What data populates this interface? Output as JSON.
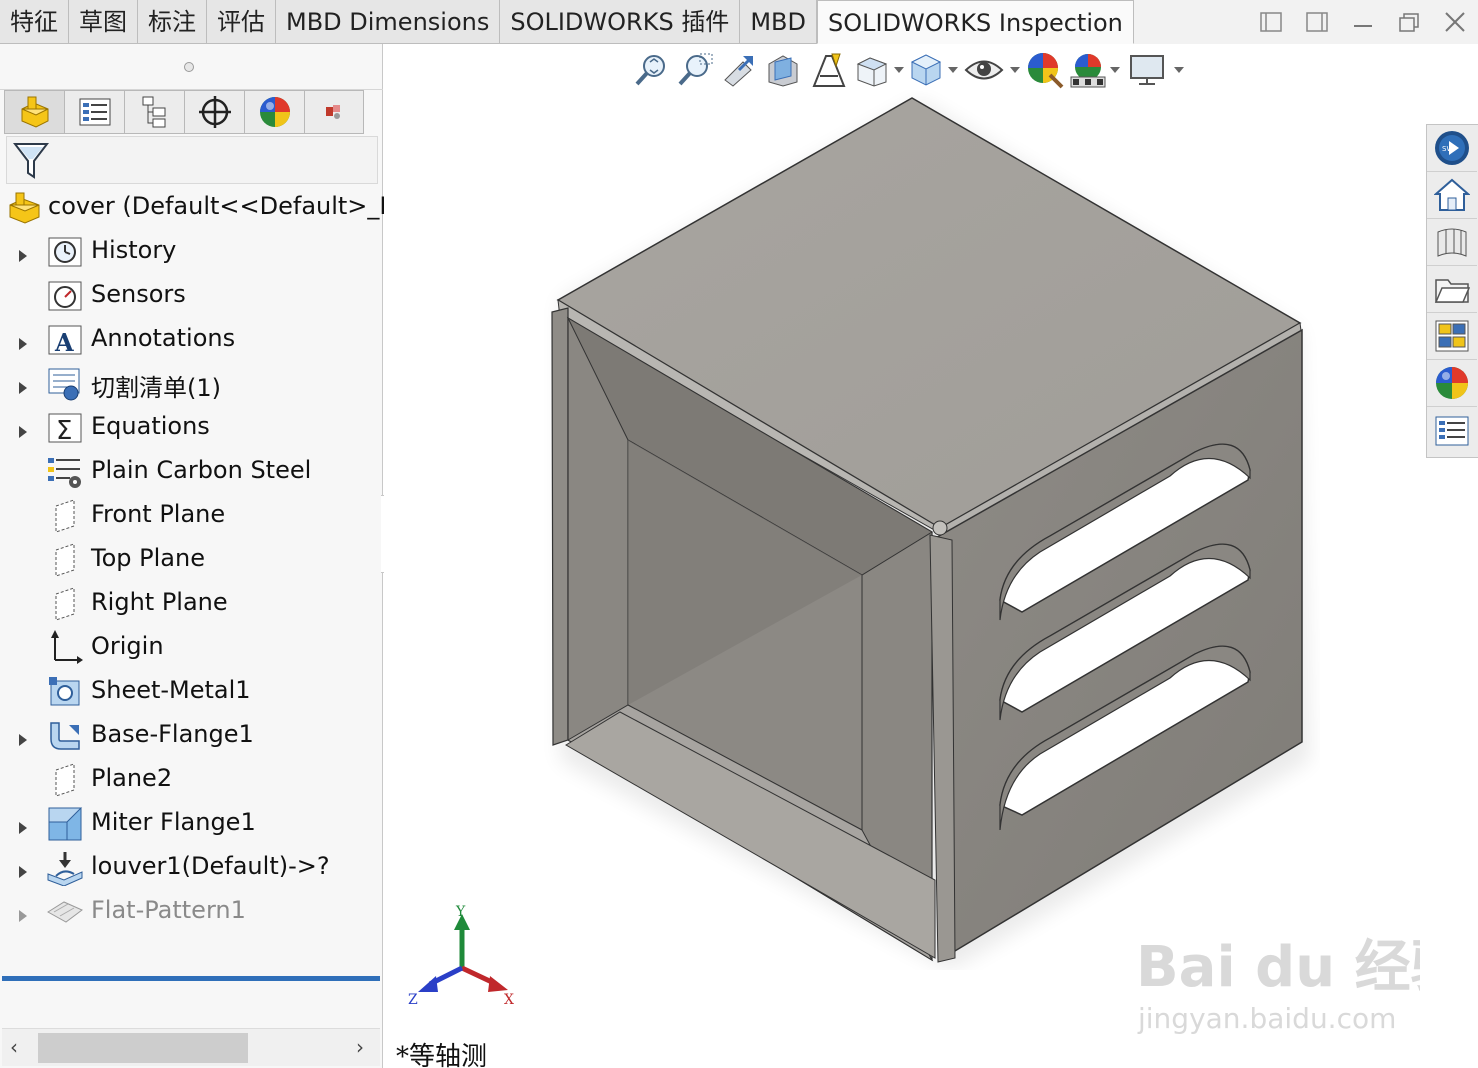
{
  "tabs": [
    "特征",
    "草图",
    "标注",
    "评估",
    "MBD Dimensions",
    "SOLIDWORKS 插件",
    "MBD",
    "SOLIDWORKS Inspection"
  ],
  "active_tab": "SOLIDWORKS Inspection",
  "window_controls": [
    "restore-pane-icon",
    "pin-pane-icon",
    "minimize-icon",
    "maximize-icon",
    "close-icon"
  ],
  "manager_tabs": [
    "featuremanager-icon",
    "propertymanager-icon",
    "configurationmanager-icon",
    "dimxpert-icon",
    "displaymanager-icon",
    "cam-icon"
  ],
  "tree": {
    "root": "cover  (Default<<Default>_D",
    "items": [
      {
        "label": "History",
        "icon": "history-icon",
        "expandable": true
      },
      {
        "label": "Sensors",
        "icon": "sensors-icon",
        "expandable": false
      },
      {
        "label": "Annotations",
        "icon": "annotations-icon",
        "expandable": true
      },
      {
        "label": "切割清单(1)",
        "icon": "cut-list-icon",
        "expandable": true
      },
      {
        "label": "Equations",
        "icon": "equations-icon",
        "expandable": true
      },
      {
        "label": "Plain Carbon Steel",
        "icon": "material-icon",
        "expandable": false
      },
      {
        "label": "Front Plane",
        "icon": "plane-icon",
        "expandable": false
      },
      {
        "label": "Top Plane",
        "icon": "plane-icon",
        "expandable": false
      },
      {
        "label": "Right Plane",
        "icon": "plane-icon",
        "expandable": false
      },
      {
        "label": "Origin",
        "icon": "origin-icon",
        "expandable": false
      },
      {
        "label": "Sheet-Metal1",
        "icon": "sheet-metal-icon",
        "expandable": false
      },
      {
        "label": "Base-Flange1",
        "icon": "base-flange-icon",
        "expandable": true
      },
      {
        "label": "Plane2",
        "icon": "plane-icon",
        "expandable": false
      },
      {
        "label": "Miter Flange1",
        "icon": "miter-flange-icon",
        "expandable": true
      },
      {
        "label": "louver1(Default)->?",
        "icon": "louver-icon",
        "expandable": true
      },
      {
        "label": "Flat-Pattern1",
        "icon": "flat-pattern-icon",
        "expandable": true,
        "suppressed": true
      }
    ]
  },
  "hud_toolbar": [
    "zoom-to-fit-icon",
    "zoom-to-area-icon",
    "previous-view-icon",
    "section-view-icon",
    "dynamic-annotation-icon",
    "view-orientation-icon",
    "display-style-icon",
    "hide-show-items-icon",
    "edit-appearance-icon",
    "apply-scene-icon",
    "view-settings-icon"
  ],
  "task_pane": [
    "solidworks-resources-icon",
    "home-icon",
    "design-library-icon",
    "file-explorer-icon",
    "view-palette-icon",
    "appearances-icon",
    "custom-properties-icon"
  ],
  "triad": {
    "x": "X",
    "y": "Y",
    "z": "Z"
  },
  "view_label": "*等轴测",
  "watermark": {
    "brand": "Bai du 经验",
    "url": "jingyan.baidu.com"
  },
  "colors": {
    "accent": "#2f6fb9",
    "model_face": "#8a8782",
    "axis_x": "#c0282b",
    "axis_y": "#1f8a3a",
    "axis_z": "#2a3fc7"
  }
}
